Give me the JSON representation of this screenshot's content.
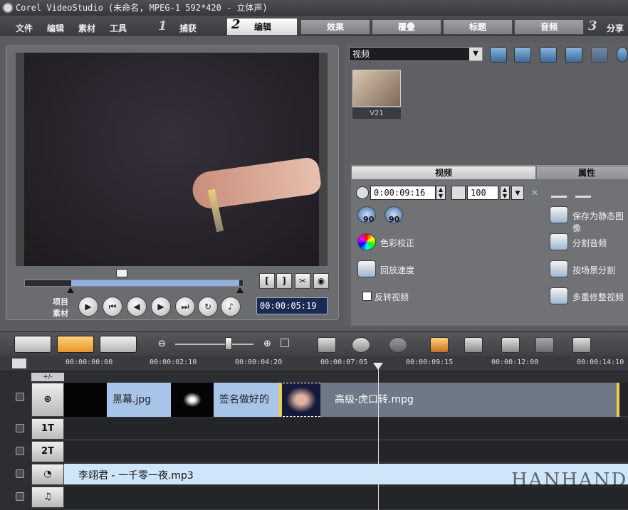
{
  "window": {
    "title": "Corel VideoStudio (未命名, MPEG-1 592*420 - 立体声)"
  },
  "menu": [
    "文件",
    "编辑",
    "素材",
    "工具"
  ],
  "steps": [
    {
      "num": "1",
      "label": "捕获"
    },
    {
      "num": "2",
      "label": "编辑"
    },
    {
      "num": "3",
      "label": "分享"
    }
  ],
  "edit_tabs": [
    "效果",
    "覆叠",
    "标题",
    "音频"
  ],
  "preview": {
    "timecode": "00:00:05:19",
    "labels": {
      "project": "项目",
      "clip": "素材"
    },
    "trim_mark_in": "[",
    "trim_mark_out": "]"
  },
  "library": {
    "category": "视频",
    "thumb_label": "V21"
  },
  "options": {
    "tabs": [
      "视频",
      "属性"
    ],
    "duration": "0:00:09:16",
    "volume": "100",
    "items": [
      "色彩校正",
      "回放速度",
      "反转视频"
    ],
    "right_items": [
      "保存为静态图像",
      "分割音频",
      "按场景分割",
      "多重修整视频"
    ],
    "rotate_values": [
      "90",
      "90"
    ]
  },
  "ruler": [
    "00:00:00:00",
    "00:00:02:10",
    "00:00:04:20",
    "00:00:07:05",
    "00:00:09:15",
    "00:00:12:00",
    "00:00:14:10"
  ],
  "tracks": {
    "title1": "1T",
    "title2": "2T",
    "video_clips": [
      {
        "name": "黑幕.jpg"
      },
      {
        "name": "签名做好的"
      },
      {
        "name": "高级-虎口转.mpg"
      }
    ],
    "music_clip": "李翊君 - 一千零一夜.mp3"
  },
  "watermark": "HANHAND"
}
